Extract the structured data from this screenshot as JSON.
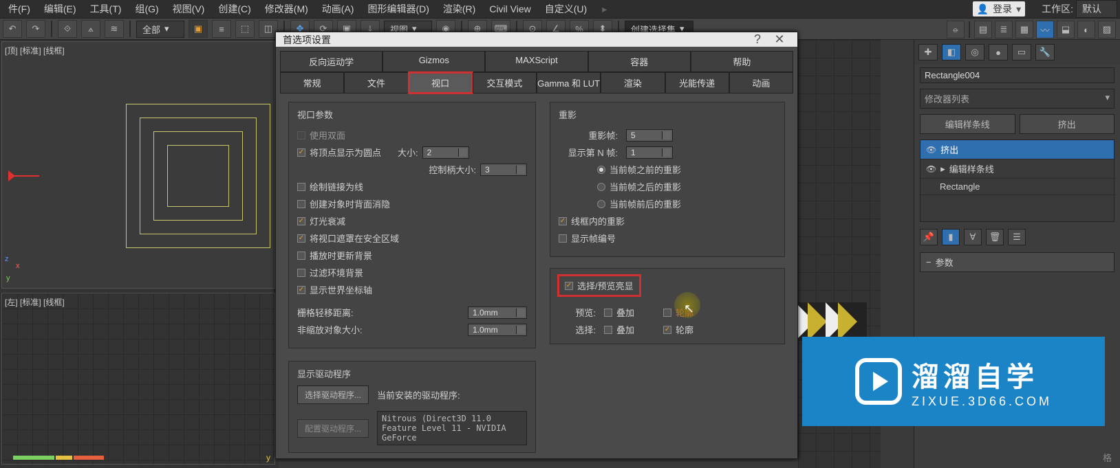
{
  "menu": {
    "file": "件(F)",
    "edit": "编辑(E)",
    "tools": "工具(T)",
    "group": "组(G)",
    "views": "视图(V)",
    "create": "创建(C)",
    "modifiers": "修改器(M)",
    "animation": "动画(A)",
    "graph": "图形编辑器(D)",
    "render": "渲染(R)",
    "civil": "Civil View",
    "customize": "自定义(U)",
    "login": "登录",
    "workspace_label": "工作区:",
    "workspace_value": "默认"
  },
  "toolbar": {
    "combo_all": "全部",
    "combo_view": "视图",
    "create_set": "创建选择集"
  },
  "viewport": {
    "top_label": "[顶] [标准] [线框]",
    "left_label": "[左] [标准] [线框]",
    "axis_y": "y",
    "axis_x": "x",
    "axis_z": "z"
  },
  "dialog": {
    "title": "首选项设置",
    "tabs_row1": [
      "反向运动学",
      "Gizmos",
      "MAXScript",
      "容器",
      "帮助"
    ],
    "tabs_row2": [
      "常规",
      "文件",
      "视口",
      "交互模式",
      "Gamma 和 LUT",
      "渲染",
      "光能传递",
      "动画"
    ],
    "active_tab": "视口",
    "vp_params_title": "视口参数",
    "opt_two_sided": "使用双面",
    "opt_vertex_dots": "将顶点显示为圆点",
    "label_size": "大小:",
    "spin_size": "2",
    "label_handle": "控制柄大小:",
    "spin_handle": "3",
    "opt_draw_links": "绘制链接为线",
    "opt_backface": "创建对象时背面消隐",
    "opt_light_atten": "灯光衰减",
    "opt_safe_frame": "将视口遮罩在安全区域",
    "opt_update_bg": "播放时更新背景",
    "opt_filter_env": "过滤环境背景",
    "opt_world_axis": "显示世界坐标轴",
    "label_grid_nudge": "栅格轻移距离:",
    "spin_grid_nudge": "1.0mm",
    "label_nonscale": "非缩放对象大小:",
    "spin_nonscale": "1.0mm",
    "ghost_title": "重影",
    "label_ghost_frames": "重影帧:",
    "spin_ghost_frames": "5",
    "label_show_nth": "显示第 N 帧:",
    "spin_show_nth": "1",
    "radio_before": "当前帧之前的重影",
    "radio_after": "当前帧之后的重影",
    "radio_both": "当前帧前后的重影",
    "opt_ghost_wire": "线框内的重影",
    "opt_show_frame_num": "显示帧编号",
    "highlight_title": "选择/预览亮显",
    "label_preview": "预览:",
    "label_select": "选择:",
    "chk_overlay": "叠加",
    "chk_outline": "轮廓",
    "driver_title": "显示驱动程序",
    "btn_choose_driver": "选择驱动程序...",
    "label_current_driver": "当前安装的驱动程序:",
    "btn_config_driver": "配置驱动程序...",
    "driver_value": "Nitrous (Direct3D 11.0 Feature Level 11 - NVIDIA GeForce"
  },
  "panel": {
    "object_name": "Rectangle004",
    "modifier_list": "修改器列表",
    "btn_edit_spline": "编辑样条线",
    "btn_extrude": "挤出",
    "stack": [
      {
        "name": "挤出",
        "sel": true,
        "eye": true,
        "expand": false
      },
      {
        "name": "编辑样条线",
        "sel": false,
        "eye": true,
        "expand": true
      },
      {
        "name": "Rectangle",
        "sel": false,
        "eye": false,
        "expand": false
      }
    ],
    "rollout_params": "参数",
    "bottom_label": "格"
  },
  "watermark": {
    "big": "溜溜自学",
    "small": "ZIXUE.3D66.COM"
  }
}
